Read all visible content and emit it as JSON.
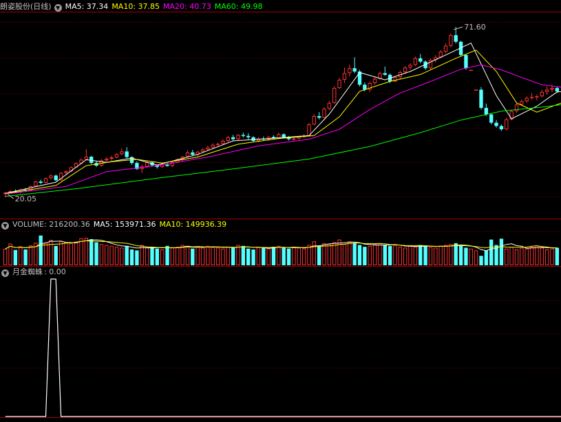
{
  "colors": {
    "up": "#ff3232",
    "down": "#54ffff",
    "ma5": "#ffffff",
    "ma10": "#ffff00",
    "ma20": "#ff00ff",
    "ma60": "#00ff00",
    "grid": "#8b0000",
    "label": "#c0c0c0"
  },
  "price_panel": {
    "stock_name": "朗姿股份(日线)",
    "ma5": "MA5: 37.34",
    "ma10": "MA10: 37.85",
    "ma20": "MA20: 40.73",
    "ma60": "MA60: 49.98",
    "high_label": "71.60",
    "low_label": "20.05"
  },
  "volume_panel": {
    "volume": "VOLUME: 216200.36",
    "ma5": "MA5: 153971.36",
    "ma10": "MA10: 149936.39"
  },
  "indicator_panel": {
    "name": "月金蜘蛛",
    "value": ": 0.00"
  },
  "chart_data": [
    {
      "type": "candlestick",
      "title": "朗姿股份(日线)",
      "ylim": [
        14,
        76
      ],
      "highest": 71.6,
      "lowest": 20.05,
      "candles": [
        [
          21.0,
          21.7,
          20.05,
          21.4
        ],
        [
          21.4,
          22.2,
          21.1,
          21.9
        ],
        [
          21.9,
          22.4,
          21.3,
          21.5
        ],
        [
          21.5,
          22.6,
          21.2,
          22.3
        ],
        [
          22.3,
          22.8,
          21.9,
          22.1
        ],
        [
          22.1,
          23.6,
          22.0,
          23.4
        ],
        [
          23.4,
          25.0,
          23.2,
          24.8
        ],
        [
          24.8,
          25.4,
          24.0,
          24.4
        ],
        [
          24.4,
          26.0,
          24.2,
          25.8
        ],
        [
          25.8,
          27.0,
          25.4,
          26.6
        ],
        [
          26.6,
          26.9,
          24.9,
          25.2
        ],
        [
          25.2,
          27.6,
          25.0,
          27.4
        ],
        [
          27.4,
          28.2,
          26.9,
          27.9
        ],
        [
          27.9,
          29.4,
          27.6,
          29.1
        ],
        [
          29.1,
          30.6,
          28.9,
          30.3
        ],
        [
          30.3,
          31.8,
          29.9,
          31.4
        ],
        [
          31.4,
          34.6,
          31.2,
          32.3
        ],
        [
          32.3,
          32.6,
          30.1,
          30.4
        ],
        [
          30.4,
          30.9,
          29.2,
          29.6
        ],
        [
          29.6,
          31.6,
          29.3,
          31.2
        ],
        [
          31.2,
          32.2,
          30.5,
          31.7
        ],
        [
          31.7,
          32.6,
          31.1,
          32.1
        ],
        [
          32.1,
          33.4,
          31.8,
          33.1
        ],
        [
          33.1,
          34.9,
          32.7,
          33.9
        ],
        [
          33.9,
          35.2,
          31.8,
          32.2
        ],
        [
          32.2,
          32.4,
          29.9,
          30.4
        ],
        [
          30.4,
          30.9,
          28.3,
          28.6
        ],
        [
          28.6,
          29.9,
          27.4,
          29.3
        ],
        [
          29.3,
          31.1,
          28.9,
          30.6
        ],
        [
          30.6,
          30.8,
          29.4,
          29.7
        ],
        [
          29.7,
          29.9,
          28.7,
          29.2
        ],
        [
          29.2,
          30.2,
          28.9,
          29.9
        ],
        [
          29.9,
          30.4,
          29.3,
          29.5
        ],
        [
          29.5,
          30.9,
          29.2,
          30.6
        ],
        [
          30.6,
          31.8,
          30.3,
          31.5
        ],
        [
          31.5,
          32.6,
          31.1,
          32.3
        ],
        [
          32.3,
          34.2,
          32.0,
          33.6
        ],
        [
          33.6,
          34.4,
          32.5,
          32.9
        ],
        [
          32.9,
          34.1,
          32.4,
          33.8
        ],
        [
          33.8,
          34.9,
          33.5,
          34.5
        ],
        [
          34.5,
          35.6,
          34.1,
          35.1
        ],
        [
          35.1,
          36.4,
          34.8,
          35.9
        ],
        [
          35.9,
          36.6,
          35.3,
          36.2
        ],
        [
          36.2,
          37.6,
          35.9,
          37.1
        ],
        [
          37.1,
          38.6,
          36.7,
          38.2
        ],
        [
          38.2,
          38.9,
          37.2,
          37.6
        ],
        [
          37.6,
          39.2,
          37.3,
          38.9
        ],
        [
          38.9,
          39.6,
          38.1,
          38.6
        ],
        [
          38.6,
          39.4,
          37.6,
          38.2
        ],
        [
          38.2,
          38.5,
          36.8,
          37.1
        ],
        [
          37.1,
          38.2,
          36.7,
          37.8
        ],
        [
          37.8,
          38.4,
          37.2,
          37.5
        ],
        [
          37.5,
          38.6,
          37.1,
          38.3
        ],
        [
          38.3,
          38.8,
          37.6,
          37.9
        ],
        [
          37.9,
          39.6,
          37.6,
          39.1
        ],
        [
          39.1,
          39.4,
          37.9,
          38.2
        ],
        [
          38.2,
          38.6,
          37.2,
          37.6
        ],
        [
          37.6,
          38.3,
          37.0,
          37.8
        ],
        [
          37.8,
          38.7,
          37.4,
          38.4
        ],
        [
          38.4,
          39.2,
          38.0,
          38.6
        ],
        [
          38.6,
          42.6,
          38.4,
          42.1
        ],
        [
          42.1,
          45.2,
          41.8,
          44.6
        ],
        [
          44.6,
          45.8,
          43.6,
          44.1
        ],
        [
          44.1,
          47.3,
          43.9,
          46.8
        ],
        [
          46.8,
          49.2,
          46.4,
          48.6
        ],
        [
          48.6,
          53.6,
          48.3,
          53.1
        ],
        [
          53.1,
          56.2,
          52.8,
          55.6
        ],
        [
          55.6,
          59.3,
          54.6,
          57.6
        ],
        [
          57.6,
          60.2,
          56.6,
          59.1
        ],
        [
          59.1,
          62.4,
          57.6,
          58.1
        ],
        [
          58.1,
          58.6,
          53.6,
          54.1
        ],
        [
          54.1,
          54.8,
          52.1,
          52.6
        ],
        [
          52.6,
          55.1,
          51.8,
          54.6
        ],
        [
          54.6,
          56.4,
          54.1,
          55.9
        ],
        [
          55.9,
          58.1,
          55.6,
          57.6
        ],
        [
          57.6,
          59.6,
          56.8,
          57.1
        ],
        [
          57.1,
          57.5,
          54.6,
          55.1
        ],
        [
          55.1,
          56.8,
          54.8,
          56.4
        ],
        [
          56.4,
          58.4,
          55.9,
          57.9
        ],
        [
          57.9,
          59.8,
          57.4,
          59.3
        ],
        [
          59.3,
          60.6,
          58.6,
          60.1
        ],
        [
          60.1,
          62.6,
          59.8,
          62.1
        ],
        [
          62.1,
          63.4,
          60.6,
          61.1
        ],
        [
          61.1,
          61.5,
          58.6,
          59.1
        ],
        [
          59.1,
          62.1,
          58.8,
          61.6
        ],
        [
          61.6,
          63.1,
          60.9,
          62.4
        ],
        [
          62.4,
          64.6,
          62.1,
          64.1
        ],
        [
          64.1,
          66.6,
          63.6,
          65.9
        ],
        [
          65.9,
          69.6,
          65.4,
          69.1
        ],
        [
          69.1,
          71.6,
          66.6,
          67.1
        ],
        [
          67.1,
          67.4,
          62.6,
          63.1
        ],
        [
          63.1,
          63.4,
          58.6,
          59.1
        ],
        [
          58.6,
          58.6,
          58.6,
          58.6
        ],
        [
          52.6,
          52.6,
          52.6,
          52.6
        ],
        [
          52.6,
          53.4,
          46.6,
          47.1
        ],
        [
          47.1,
          48.4,
          44.6,
          45.1
        ],
        [
          45.1,
          45.4,
          42.1,
          42.6
        ],
        [
          42.6,
          43.4,
          41.1,
          41.6
        ],
        [
          41.6,
          42.1,
          40.1,
          40.6
        ],
        [
          40.6,
          44.1,
          40.3,
          43.6
        ],
        [
          43.6,
          46.6,
          43.3,
          46.1
        ],
        [
          46.1,
          48.6,
          45.6,
          48.1
        ],
        [
          48.1,
          49.6,
          47.6,
          49.1
        ],
        [
          49.1,
          50.6,
          48.6,
          50.1
        ],
        [
          50.1,
          51.6,
          49.6,
          50.4
        ],
        [
          50.4,
          51.1,
          49.4,
          50.6
        ],
        [
          50.6,
          52.6,
          50.3,
          51.9
        ],
        [
          51.9,
          53.6,
          51.1,
          52.6
        ],
        [
          52.6,
          54.1,
          51.9,
          53.1
        ],
        [
          53.1,
          53.6,
          51.6,
          52.1
        ]
      ],
      "ma_series": [
        {
          "name": "MA5",
          "color": "#ffffff",
          "points": [
            [
              0,
              21.2
            ],
            [
              10,
              24.6
            ],
            [
              16,
              31.4
            ],
            [
              20,
              30.6
            ],
            [
              25,
              31.9
            ],
            [
              30,
              29.8
            ],
            [
              38,
              33.0
            ],
            [
              45,
              37.1
            ],
            [
              52,
              37.8
            ],
            [
              60,
              38.7
            ],
            [
              64,
              45.2
            ],
            [
              70,
              57.8
            ],
            [
              75,
              55.6
            ],
            [
              80,
              58.1
            ],
            [
              88,
              63.8
            ],
            [
              92,
              66.7
            ],
            [
              97,
              50.8
            ],
            [
              100,
              43.8
            ],
            [
              105,
              47.6
            ],
            [
              109,
              51.9
            ],
            [
              114,
              52.4
            ]
          ]
        },
        {
          "name": "MA10",
          "color": "#ffff00",
          "points": [
            [
              0,
              21.1
            ],
            [
              10,
              23.6
            ],
            [
              16,
              29.6
            ],
            [
              21,
              30.8
            ],
            [
              26,
              31.5
            ],
            [
              31,
              30.4
            ],
            [
              38,
              32.2
            ],
            [
              46,
              36.1
            ],
            [
              54,
              37.8
            ],
            [
              61,
              38.7
            ],
            [
              66,
              44.4
            ],
            [
              70,
              52.1
            ],
            [
              76,
              55.1
            ],
            [
              82,
              57.2
            ],
            [
              89,
              62.1
            ],
            [
              93,
              64.6
            ],
            [
              97,
              58.1
            ],
            [
              101,
              48.6
            ],
            [
              105,
              45.8
            ],
            [
              109,
              48.1
            ],
            [
              114,
              50.9
            ]
          ]
        },
        {
          "name": "MA20",
          "color": "#ff00ff",
          "points": [
            [
              0,
              21.0
            ],
            [
              12,
              23.3
            ],
            [
              20,
              27.8
            ],
            [
              30,
              29.6
            ],
            [
              40,
              32.2
            ],
            [
              50,
              35.6
            ],
            [
              60,
              37.6
            ],
            [
              66,
              40.6
            ],
            [
              72,
              46.6
            ],
            [
              78,
              51.6
            ],
            [
              84,
              55.1
            ],
            [
              90,
              58.8
            ],
            [
              94,
              60.1
            ],
            [
              98,
              58.6
            ],
            [
              102,
              56.3
            ],
            [
              106,
              54.1
            ],
            [
              110,
              53.3
            ],
            [
              114,
              52.8
            ]
          ]
        },
        {
          "name": "MA60",
          "color": "#00ff00",
          "points": [
            [
              0,
              20.3
            ],
            [
              15,
              22.8
            ],
            [
              30,
              25.8
            ],
            [
              45,
              28.6
            ],
            [
              60,
              31.6
            ],
            [
              72,
              35.4
            ],
            [
              82,
              39.6
            ],
            [
              90,
              43.4
            ],
            [
              98,
              46.1
            ],
            [
              106,
              47.3
            ],
            [
              114,
              48.9
            ]
          ]
        }
      ]
    },
    {
      "type": "bar",
      "title": "VOLUME",
      "ylim": [
        0,
        400000
      ],
      "series": [
        {
          "name": "VOLUME",
          "values": [
            182000,
            240000,
            170000,
            210000,
            175000,
            220000,
            250000,
            330000,
            255000,
            280000,
            215000,
            265000,
            255000,
            245000,
            260000,
            300000,
            305000,
            290000,
            255000,
            235000,
            225000,
            215000,
            205000,
            195000,
            215000,
            175000,
            165000,
            225000,
            195000,
            205000,
            185000,
            175000,
            215000,
            195000,
            205000,
            225000,
            215000,
            185000,
            205000,
            195000,
            215000,
            205000,
            195000,
            185000,
            205000,
            195000,
            225000,
            215000,
            185000,
            175000,
            205000,
            195000,
            185000,
            205000,
            215000,
            195000,
            185000,
            205000,
            195000,
            185000,
            225000,
            265000,
            215000,
            245000,
            235000,
            255000,
            285000,
            235000,
            265000,
            245000,
            225000,
            205000,
            215000,
            235000,
            245000,
            225000,
            215000,
            225000,
            205000,
            195000,
            215000,
            205000,
            225000,
            215000,
            205000,
            195000,
            215000,
            225000,
            235000,
            245000,
            215000,
            195000,
            185000,
            165000,
            105000,
            165000,
            285000,
            225000,
            295000,
            185000,
            205000,
            175000,
            195000,
            185000,
            205000,
            215000,
            195000,
            175000,
            185000,
            195000
          ]
        },
        {
          "name": "MA5",
          "values": []
        },
        {
          "name": "MA10",
          "values": []
        }
      ]
    },
    {
      "type": "line",
      "title": "月金蜘蛛",
      "ylim": [
        0,
        1
      ],
      "series": [
        {
          "name": "月金蜘蛛",
          "points": [
            [
              0,
              0
            ],
            [
              8,
              0
            ],
            [
              9,
              1
            ],
            [
              10,
              1
            ],
            [
              11,
              0
            ],
            [
              114,
              0
            ]
          ]
        }
      ]
    }
  ]
}
